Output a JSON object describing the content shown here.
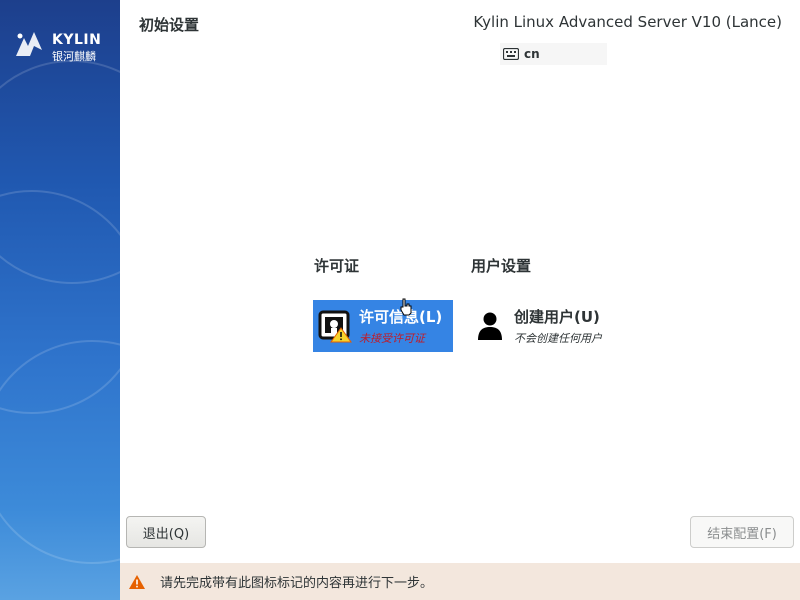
{
  "sidebar": {
    "logo_text": "KYLIN",
    "logo_sub": "银河麒麟"
  },
  "header": {
    "title": "初始设置",
    "product": "Kylin Linux Advanced Server V10 (Lance)",
    "keyboard_layout": "cn",
    "keyboard_icon": "keyboard-icon"
  },
  "hub": {
    "categories": [
      {
        "title": "许可证",
        "spokes": [
          {
            "label": "许可信息(L)",
            "status": "未接受许可证",
            "icon": "license-warning-icon",
            "selected": true
          }
        ]
      },
      {
        "title": "用户设置",
        "spokes": [
          {
            "label": "创建用户(U)",
            "status": "不会创建任何用户",
            "icon": "user-icon",
            "selected": false
          }
        ]
      }
    ]
  },
  "buttons": {
    "quit": "退出(Q)",
    "finish": "结束配置(F)"
  },
  "warning": {
    "icon": "warning-icon",
    "text": "请先完成带有此图标标记的内容再进行下一步。"
  },
  "colors": {
    "selected_spoke": "#3584e4",
    "warning_bg": "#f3e7dd",
    "warning_icon": "#e66100",
    "status_warning_text": "#c01c28"
  }
}
